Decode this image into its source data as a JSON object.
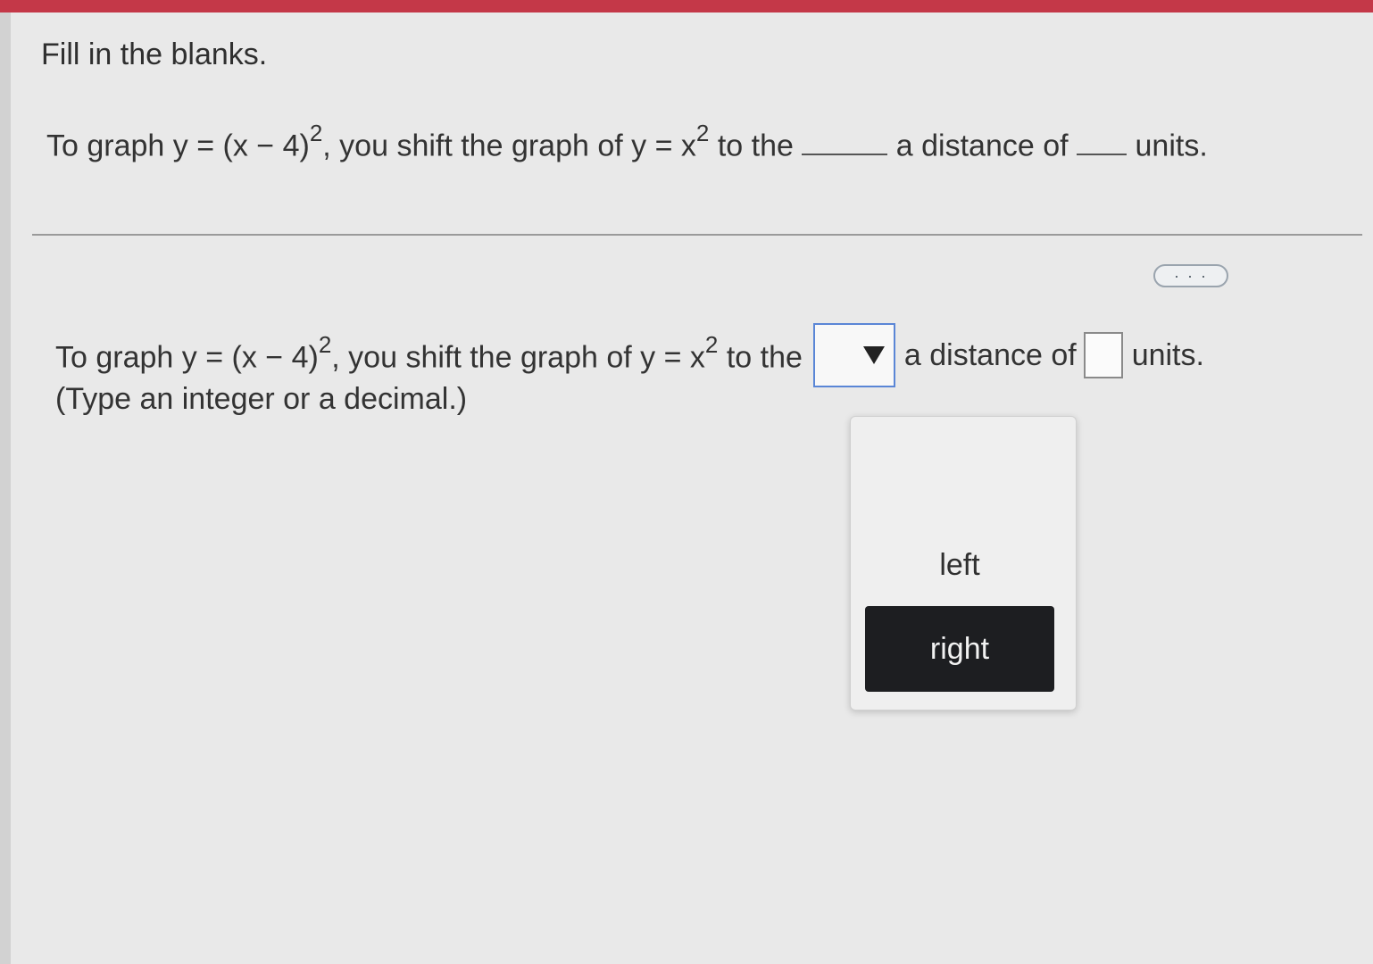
{
  "header": {
    "instruction": "Fill in the blanks."
  },
  "statement": {
    "prefix": "To graph y = (x − 4)",
    "exponent1": "2",
    "middle": ", you shift the graph of y = x",
    "exponent2": "2",
    "to_the": " to the ",
    "distance_label": " a distance of ",
    "units_label": " units."
  },
  "answer": {
    "prefix": "To graph y = (x − 4)",
    "exponent1": "2",
    "middle": ", you shift the graph of y = x",
    "exponent2": "2",
    "to_the": " to the",
    "distance_label": "a distance of",
    "units_label": "units.",
    "hint": "(Type an integer or a decimal.)",
    "direction_value": "",
    "distance_value": ""
  },
  "more_button": {
    "label": "· · ·"
  },
  "direction_menu": {
    "options": [
      "left",
      "right"
    ],
    "highlighted": "right"
  },
  "colors": {
    "top_bar": "#c43848",
    "dropdown_border": "#5a86d6",
    "highlight_bg": "#1d1e21"
  },
  "icons": {
    "dropdown": "triangle-down-icon"
  }
}
